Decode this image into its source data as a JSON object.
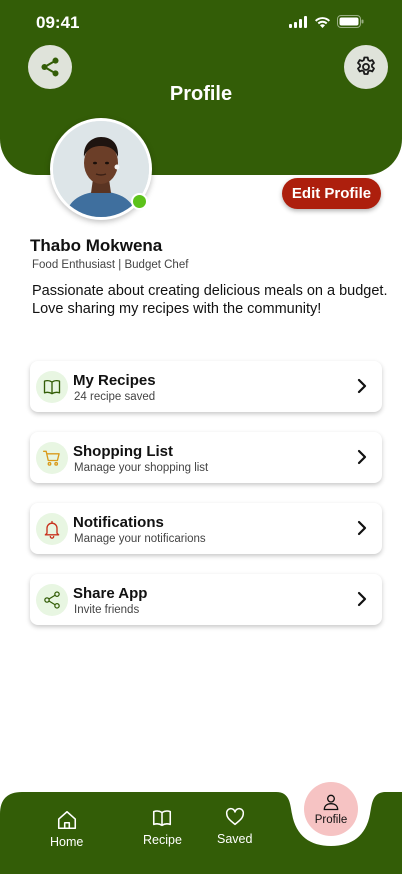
{
  "status": {
    "time": "09:41"
  },
  "header": {
    "title": "Profile",
    "share_icon": "share-icon",
    "settings_icon": "gear-icon",
    "bg_color": "#335d07"
  },
  "profile": {
    "edit_label": "Edit Profile",
    "name": "Thabo Mokwena",
    "tagline": "Food Enthusiast | Budget Chef",
    "bio": "Passionate about creating delicious meals on a budget. Love sharing my recipes with the community!",
    "online": true
  },
  "menu": [
    {
      "title": "My Recipes",
      "subtitle": "24 recipe saved",
      "icon": "book-icon"
    },
    {
      "title": "Shopping List",
      "subtitle": "Manage your shopping list",
      "icon": "cart-icon"
    },
    {
      "title": "Notifications",
      "subtitle": "Manage your notificarions",
      "icon": "bell-icon"
    },
    {
      "title": "Share App",
      "subtitle": "Invite friends",
      "icon": "share-icon"
    }
  ],
  "nav": {
    "home": "Home",
    "recipe": "Recipe",
    "saved": "Saved",
    "profile": "Profile",
    "active": "Profile"
  },
  "colors": {
    "primary": "#335d07",
    "accent": "#ad1f0d",
    "active_nav": "#f6c3c3"
  }
}
